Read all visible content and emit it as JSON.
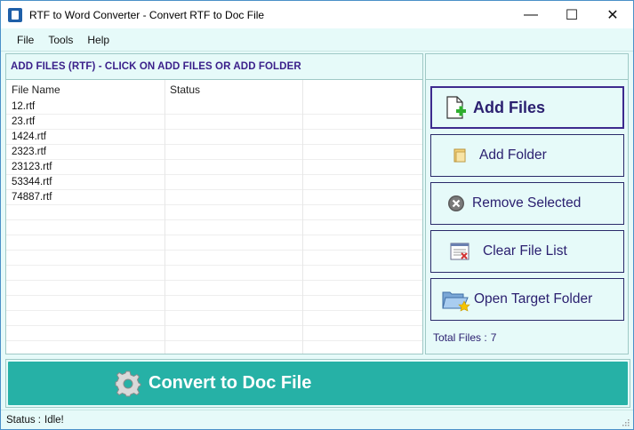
{
  "window": {
    "title": "RTF to Word Converter -  Convert RTF to Doc File",
    "minimize_glyph": "—",
    "maximize_glyph": "☐",
    "close_glyph": "✕"
  },
  "menu": {
    "items": [
      {
        "label": "File"
      },
      {
        "label": "Tools"
      },
      {
        "label": "Help"
      }
    ]
  },
  "files_panel": {
    "header": "ADD FILES (RTF) - CLICK ON ADD FILES OR ADD FOLDER",
    "columns": [
      "File Name",
      "Status"
    ],
    "rows": [
      {
        "name": "12.rtf",
        "status": ""
      },
      {
        "name": "23.rtf",
        "status": ""
      },
      {
        "name": "1424.rtf",
        "status": ""
      },
      {
        "name": "2323.rtf",
        "status": ""
      },
      {
        "name": "23123.rtf",
        "status": ""
      },
      {
        "name": "53344.rtf",
        "status": ""
      },
      {
        "name": "74887.rtf",
        "status": ""
      }
    ]
  },
  "actions": {
    "add_files": "Add Files",
    "add_folder": "Add Folder",
    "remove_selected": "Remove Selected",
    "clear_list": "Clear File List",
    "open_target": "Open Target Folder",
    "total_label": "Total Files :",
    "total_count": "7"
  },
  "convert": {
    "label": "Convert to Doc File"
  },
  "status": {
    "label": "Status  :",
    "value": "Idle!"
  },
  "colors": {
    "accent": "#26b1a6",
    "background": "#e6faf9",
    "header_text": "#3a1f8a"
  },
  "icons": {
    "app": "app-icon",
    "add_files": "document-plus-icon",
    "add_folder": "folder-icon",
    "remove": "remove-circle-icon",
    "clear": "clear-list-icon",
    "open_target": "open-folder-icon",
    "convert": "gear-icon"
  }
}
